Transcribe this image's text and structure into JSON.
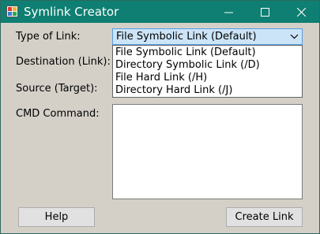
{
  "window": {
    "title": "Symlink Creator",
    "titlebar_color": "#0e7f72",
    "controls": [
      "minimize-icon",
      "maximize-icon",
      "close-icon"
    ]
  },
  "form": {
    "link_type_label": "Type of Link:",
    "destination_label": "Destination (Link):",
    "source_label": "Source (Target):",
    "cmd_label": "CMD Command:",
    "link_type_selected": "File Symbolic Link (Default)",
    "link_type_options": [
      "File Symbolic Link (Default)",
      "Directory Symbolic Link (/D)",
      "File Hard Link (/H)",
      "Directory Hard Link (/J)"
    ],
    "cmd_command_value": ""
  },
  "buttons": {
    "help": "Help",
    "create_link": "Create Link"
  }
}
